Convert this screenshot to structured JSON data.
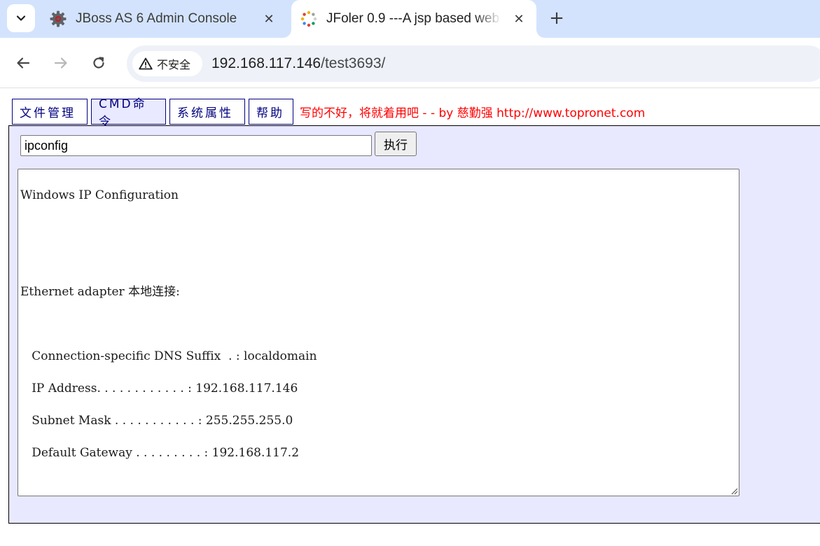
{
  "browser": {
    "tabs": [
      {
        "title": "JBoss AS 6 Admin Console",
        "icon": "gear-icon",
        "active": false
      },
      {
        "title": "JFoler 0.9 ---A jsp based web",
        "icon": "loading-spinner-icon",
        "active": true
      }
    ],
    "security_label": "不安全",
    "url_host": "192.168.117.146",
    "url_path": "/test3693/"
  },
  "menu": {
    "file_manager": "文件管理",
    "cmd": "CMD命令",
    "system_properties": "系统属性",
    "help": "帮助",
    "note": "写的不好，将就着用吧 - - by 慈勤强 http://www.topronet.com"
  },
  "command": {
    "value": "ipconfig",
    "execute_label": "执行"
  },
  "output": {
    "lines": [
      "Windows IP Configuration",
      "Ethernet adapter 本地连接:",
      "   Connection-specific DNS Suffix  . : localdomain",
      "   IP Address. . . . . . . . . . . . : 192.168.117.146",
      "   Subnet Mask . . . . . . . . . . . : 255.255.255.0",
      "   Default Gateway . . . . . . . . . : 192.168.117.2"
    ]
  },
  "colors": {
    "tabstrip": "#d3e3fd",
    "menu_border": "#000080",
    "note": "#ff0000",
    "panel": "#e8e8ff"
  }
}
